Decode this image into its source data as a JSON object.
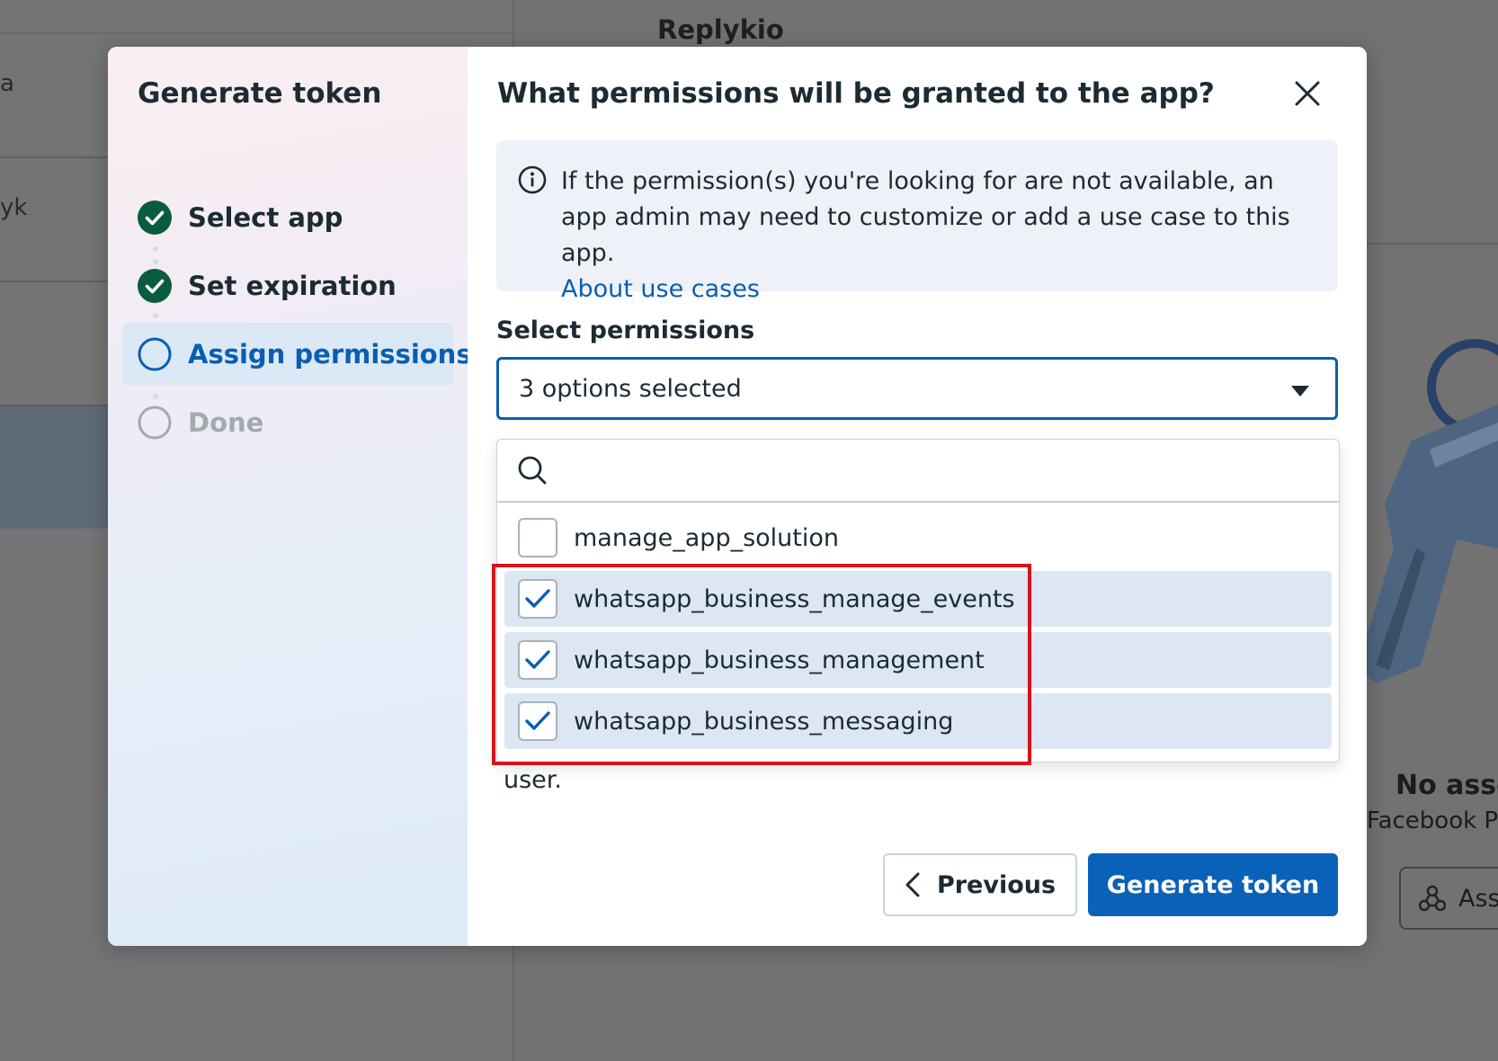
{
  "background": {
    "app_name": "Replykio",
    "left_row_1_text": "a",
    "left_row_2_text": "yk",
    "empty_state_title": "No asse",
    "empty_state_subtitle": "Facebook P",
    "assign_button_label": "Ass"
  },
  "stepper": {
    "title": "Generate token",
    "steps": [
      {
        "label": "Select app",
        "status": "done"
      },
      {
        "label": "Set expiration",
        "status": "done"
      },
      {
        "label": "Assign permissions",
        "status": "active"
      },
      {
        "label": "Done",
        "status": "pending"
      }
    ]
  },
  "content": {
    "title": "What permissions will be granted to the app?",
    "info": {
      "text": "If the permission(s) you're looking for are not available, an app admin may need to customize or add a use case to this app.",
      "link": "About use cases"
    },
    "select_label": "Select permissions",
    "select_value": "3 options selected",
    "search_placeholder": "",
    "options": [
      {
        "label": "manage_app_solution",
        "checked": false
      },
      {
        "label": "whatsapp_business_manage_events",
        "checked": true
      },
      {
        "label": "whatsapp_business_management",
        "checked": true
      },
      {
        "label": "whatsapp_business_messaging",
        "checked": true
      }
    ],
    "underlying_text_tail": "user.",
    "previous_label": "Previous",
    "primary_label": "Generate token"
  },
  "colors": {
    "primary": "#0a62b8",
    "step_done": "#0b5c3e",
    "highlight_frame": "#d6131b"
  }
}
